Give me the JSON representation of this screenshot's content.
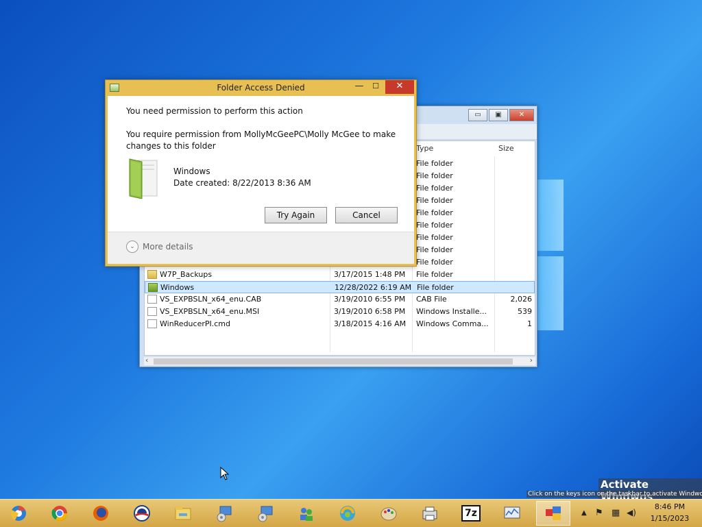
{
  "dialog": {
    "title": "Folder Access Denied",
    "message_heading": "You need permission to perform this action",
    "message_line1": "You require permission from MollyMcGeePC\\Molly McGee to make",
    "message_line2": "changes to this folder",
    "item_name": "Windows",
    "item_date": "Date created: 8/22/2013 8:36 AM",
    "try_again_label": "Try Again",
    "cancel_label": "Cancel",
    "more_details_label": "More details",
    "minimize_glyph": "—",
    "maximize_glyph": "☐",
    "close_glyph": "✕"
  },
  "explorer": {
    "minimize_glyph": "▭",
    "maximize_glyph": "▣",
    "close_glyph": "✕",
    "columns": {
      "type": "Type",
      "size": "Size"
    },
    "rows_partial": [
      {
        "type": "File folder"
      },
      {
        "type": "File folder"
      },
      {
        "type": "File folder"
      },
      {
        "type": "File folder"
      },
      {
        "type": "File folder"
      },
      {
        "type": "File folder"
      },
      {
        "type": "File folder"
      },
      {
        "type": "File folder"
      },
      {
        "type": "File folder"
      }
    ],
    "rows": [
      {
        "name": "W7P_Backups",
        "date": "3/17/2015 1:48 PM",
        "type": "File folder",
        "size": "",
        "icon": "folder-icon"
      },
      {
        "name": "Windows",
        "date": "12/28/2022 6:19 AM",
        "type": "File folder",
        "size": "",
        "icon": "folder-icon",
        "selected": true
      },
      {
        "name": "VS_EXPBSLN_x64_enu.CAB",
        "date": "3/19/2010 6:55 PM",
        "type": "CAB File",
        "size": "2,026",
        "icon": "cab-file-icon"
      },
      {
        "name": "VS_EXPBSLN_x64_enu.MSI",
        "date": "3/19/2010 6:58 PM",
        "type": "Windows Installe...",
        "size": "539",
        "icon": "installer-icon"
      },
      {
        "name": "WinReducerPI.cmd",
        "date": "3/18/2015 4:16 AM",
        "type": "Windows Comma...",
        "size": "1",
        "icon": "cmd-file-icon"
      }
    ],
    "scroll_left": "‹",
    "scroll_right": "›"
  },
  "watermark": {
    "title": "Activate Windwos",
    "subtitle": "Click on the keys icon on the taskbar to activate Windwos."
  },
  "taskbar": {
    "apps": [
      "chromium-icon",
      "chrome-icon",
      "firefox-icon",
      "campaign-logo-icon",
      "file-explorer-icon",
      "setup-wizard-icon",
      "setup-wizard-2-icon",
      "network-users-icon",
      "swirl-app-icon",
      "paint-icon",
      "printer-icon",
      "7zip-icon",
      "system-monitor-icon",
      "control-panel-icon"
    ],
    "seven_zip_label": "7z",
    "tray_arrow": "▲",
    "tray_flag": "⚑",
    "tray_network": "▦",
    "tray_volume": "◀)",
    "time": "8:46 PM",
    "date": "1/15/2023"
  }
}
